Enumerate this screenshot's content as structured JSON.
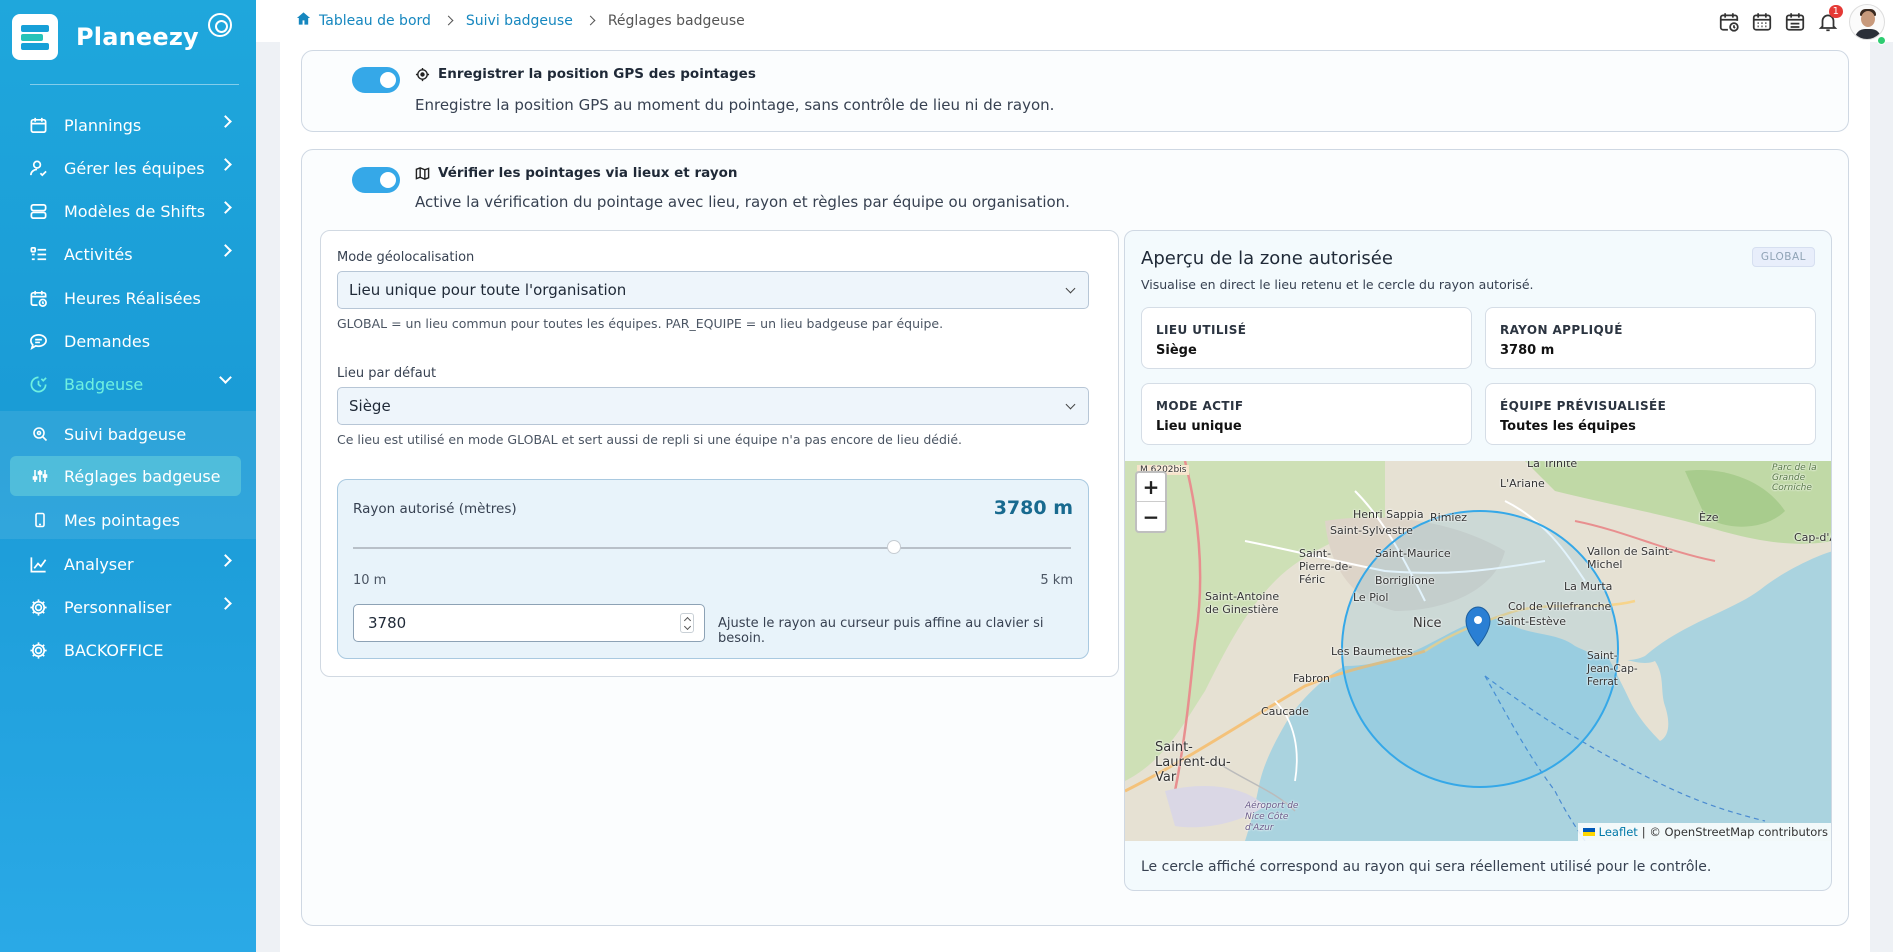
{
  "app": {
    "name": "Planeezy"
  },
  "sidebar": {
    "items": [
      {
        "label": "Plannings",
        "icon": "calendar-icon"
      },
      {
        "label": "Gérer les équipes",
        "icon": "user-check-icon"
      },
      {
        "label": "Modèles de Shifts",
        "icon": "stack-icon"
      },
      {
        "label": "Activités",
        "icon": "list-icon"
      },
      {
        "label": "Heures Réalisées",
        "icon": "calendar-clock-icon"
      },
      {
        "label": "Demandes",
        "icon": "chat-icon"
      },
      {
        "label": "Badgeuse",
        "icon": "clock-check-icon"
      },
      {
        "label": "Analyser",
        "icon": "chart-icon"
      },
      {
        "label": "Personnaliser",
        "icon": "gear-icon"
      },
      {
        "label": "BACKOFFICE",
        "icon": "gear-icon"
      }
    ],
    "sub_items": [
      {
        "label": "Suivi badgeuse",
        "icon": "search-icon"
      },
      {
        "label": "Réglages badgeuse",
        "icon": "sliders-icon"
      },
      {
        "label": "Mes pointages",
        "icon": "phone-icon"
      }
    ]
  },
  "breadcrumb": {
    "home": "Tableau de bord",
    "parent": "Suivi badgeuse",
    "current": "Réglages badgeuse"
  },
  "topbar": {
    "notifications_count": "1"
  },
  "settings": {
    "gps": {
      "title": "Enregistrer la position GPS des pointages",
      "description": "Enregistre la position GPS au moment du pointage, sans contrôle de lieu ni de rayon.",
      "enabled": true
    },
    "verify": {
      "title": "Vérifier les pointages via lieux et rayon",
      "description": "Active la vérification du pointage avec lieu, rayon et règles par équipe ou organisation.",
      "enabled": true
    }
  },
  "form": {
    "mode_label": "Mode géolocalisation",
    "mode_value": "Lieu unique pour toute l'organisation",
    "mode_hint": "GLOBAL = un lieu commun pour toutes les équipes. PAR_EQUIPE = un lieu badgeuse par équipe.",
    "place_label": "Lieu par défaut",
    "place_value": "Siège",
    "place_hint": "Ce lieu est utilisé en mode GLOBAL et sert aussi de repli si une équipe n'a pas encore de lieu dédié.",
    "radius_label": "Rayon autorisé (mètres)",
    "radius_display": "3780 m",
    "radius_min_label": "10 m",
    "radius_max_label": "5 km",
    "radius_input": "3780",
    "radius_hint": "Ajuste le rayon au curseur puis affine au clavier si besoin.",
    "radius_fraction": 0.754
  },
  "preview": {
    "title": "Aperçu de la zone autorisée",
    "subtitle": "Visualise en direct le lieu retenu et le cercle du rayon autorisé.",
    "badge": "GLOBAL",
    "stats": [
      {
        "key": "LIEU UTILISÉ",
        "value": "Siège"
      },
      {
        "key": "RAYON APPLIQUÉ",
        "value": "3780 m"
      },
      {
        "key": "MODE ACTIF",
        "value": "Lieu unique"
      },
      {
        "key": "ÉQUIPE PRÉVISUALISÉE",
        "value": "Toutes les équipes"
      }
    ],
    "caption": "Le cercle affiché correspond au rayon qui sera réellement utilisé pour le contrôle."
  },
  "map": {
    "zoom_in": "+",
    "zoom_out": "−",
    "attribution_link": "Leaflet",
    "attribution_text": "| © OpenStreetMap contributors",
    "labels": {
      "m6202": "M 6202bis",
      "turbie": "La Trinité",
      "ariane": "L'Ariane",
      "henri": "Henri Sappia",
      "sylvestre": "Saint-Sylvestre",
      "rimiez": "Rimiez",
      "eze": "Èze",
      "capail": "Cap-d'Ail",
      "villefranche_vallon": "Vallon de Saint-Michel",
      "pierre": "Saint-Pierre-de-Féric",
      "maurice": "Saint-Maurice",
      "murta": "La Murta",
      "antoine": "Saint-Antoine de Ginestière",
      "borriglione": "Borriglione",
      "piol": "Le Piol",
      "colvillefranche": "Col de Villefranche",
      "esteve": "Saint-Estève",
      "nice": "Nice",
      "baumettes": "Les Baumettes",
      "capferrat": "Saint-Jean-Cap-Ferrat",
      "fabron": "Fabron",
      "caucade": "Caucade",
      "laurent": "Saint-Laurent-du-Var",
      "aeroport": "Aéroport de Nice Côte d'Azur",
      "grande_corniche": "Parc de la Grande Corniche"
    }
  },
  "colors": {
    "accent": "#35a8e8",
    "sidebar": "#1fa7dc",
    "link": "#1687bf",
    "sea": "#aad3df",
    "circle": "#35a8e8"
  }
}
